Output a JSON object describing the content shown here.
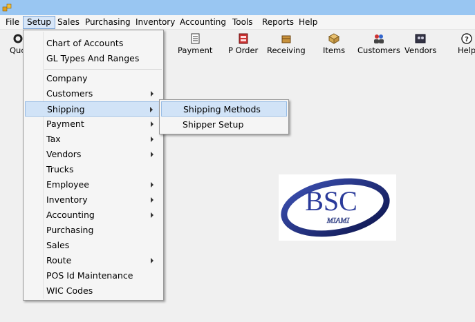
{
  "window": {
    "icon": "app-icon"
  },
  "menubar": [
    "File",
    "Setup",
    "Sales",
    "Purchasing",
    "Inventory",
    "Accounting",
    "Tools",
    "Reports",
    "Help"
  ],
  "toolbar": {
    "quick_label": "Quo",
    "payment": "Payment",
    "porder": "P Order",
    "receiving": "Receiving",
    "items": "Items",
    "customers": "Customers",
    "vendors": "Vendors",
    "help": "Help"
  },
  "setup_menu": {
    "items": [
      {
        "label": "Chart of Accounts"
      },
      {
        "label": "GL Types And Ranges"
      },
      {
        "label": "Company"
      },
      {
        "label": "Customers"
      },
      {
        "label": "Shipping"
      },
      {
        "label": "Payment"
      },
      {
        "label": "Tax"
      },
      {
        "label": "Vendors"
      },
      {
        "label": "Trucks"
      },
      {
        "label": "Employee"
      },
      {
        "label": "Inventory"
      },
      {
        "label": "Accounting"
      },
      {
        "label": "Purchasing"
      },
      {
        "label": "Sales"
      },
      {
        "label": "Route"
      },
      {
        "label": "POS Id Maintenance"
      },
      {
        "label": "WIC Codes"
      }
    ]
  },
  "shipping_submenu": {
    "items": [
      {
        "label": "Shipping Methods"
      },
      {
        "label": "Shipper Setup"
      }
    ]
  },
  "logo": {
    "main": "BSC",
    "sub": "MIAMI"
  },
  "colors": {
    "titlebar": "#99c6f2",
    "highlight": "#d1e3f7",
    "logo_navy": "#1e2e7a"
  }
}
